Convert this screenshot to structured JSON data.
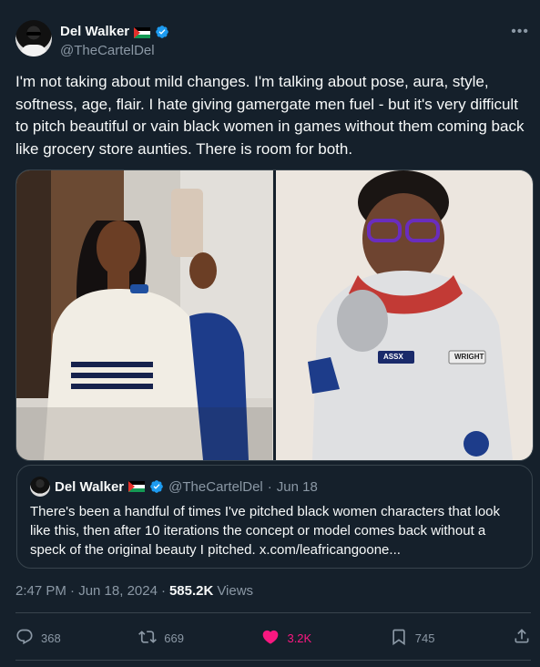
{
  "author": {
    "display_name": "Del Walker",
    "handle": "@TheCartelDel"
  },
  "tweet": {
    "text": "I'm not taking about mild changes. I'm talking about pose, aura, style, softness, age, flair. I hate giving gamergate men fuel - but it's very difficult to pitch beautiful or vain black women in games without them coming back like grocery store aunties. There is room for both.",
    "timestamp": "2:47 PM · Jun 18, 2024",
    "separator": "·",
    "views_count": "585.2K",
    "views_label": "Views"
  },
  "media": {
    "right_image_badges": [
      "ASSX",
      "WRIGHT"
    ]
  },
  "quoted_tweet": {
    "display_name": "Del Walker",
    "handle": "@TheCartelDel",
    "separator": "·",
    "date": "Jun 18",
    "text": "There's been a handful of times I've pitched black women characters that look like this, then after 10 iterations the concept or model comes back without a speck of the original beauty I pitched. x.com/leafricangoone..."
  },
  "actions": {
    "replies": "368",
    "reposts": "669",
    "likes": "3.2K",
    "bookmarks": "745"
  },
  "colors": {
    "background": "#15202b",
    "text": "#f7f9f9",
    "secondary": "#8b98a5",
    "border": "#38444d",
    "verified": "#1d9bf0",
    "like": "#f91880"
  },
  "icons": [
    "more-icon",
    "verified-badge-icon",
    "palestine-flag-icon",
    "reply-icon",
    "repost-icon",
    "like-icon",
    "bookmark-icon",
    "share-icon"
  ]
}
